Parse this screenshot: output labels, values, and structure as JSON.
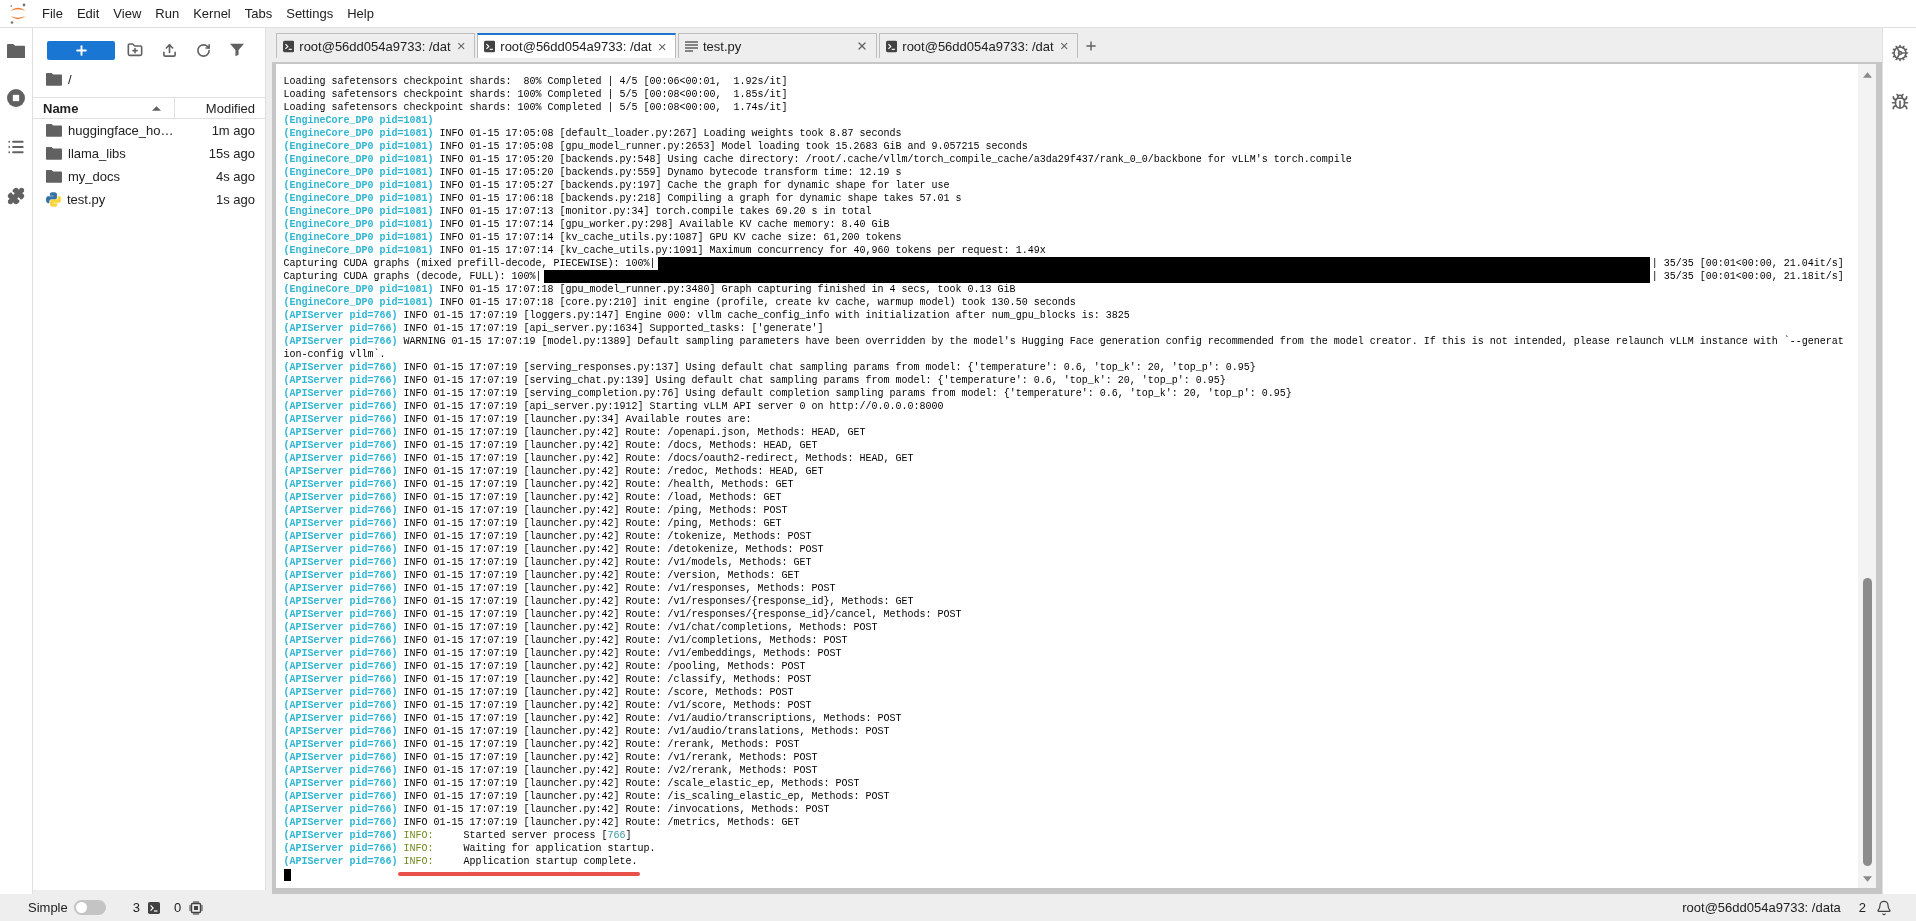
{
  "menu_bar": {
    "items": [
      "File",
      "Edit",
      "View",
      "Run",
      "Kernel",
      "Tabs",
      "Settings",
      "Help"
    ]
  },
  "file_browser": {
    "path": "/",
    "columns": [
      {
        "label": "Name",
        "sorted": true
      },
      {
        "label": "Modified",
        "sorted": false
      }
    ],
    "items": [
      {
        "kind": "folder",
        "name": "huggingface_ho…",
        "modified": "1m ago"
      },
      {
        "kind": "folder",
        "name": "llama_libs",
        "modified": "15s ago"
      },
      {
        "kind": "folder",
        "name": "my_docs",
        "modified": "4s ago"
      },
      {
        "kind": "python",
        "name": "test.py",
        "modified": "1s ago"
      }
    ]
  },
  "tabs": [
    {
      "kind": "terminal",
      "label": "root@56dd054a9733: /dat",
      "selected": false
    },
    {
      "kind": "terminal",
      "label": "root@56dd054a9733: /dat",
      "selected": true
    },
    {
      "kind": "editor",
      "label": "test.py",
      "selected": false
    },
    {
      "kind": "terminal",
      "label": "root@56dd054a9733: /dat",
      "selected": false
    }
  ],
  "terminal": {
    "lines": [
      {
        "kind": "log",
        "underlined": false,
        "segments": [
          {
            "kind": "message",
            "text": "Loading safetensors checkpoint shards:  80% Completed | 4/5 [00:06<00:01,  1.92s/it]"
          }
        ]
      },
      {
        "kind": "log",
        "underlined": false,
        "segments": [
          {
            "kind": "message",
            "text": "Loading safetensors checkpoint shards: 100% Completed | 5/5 [00:08<00:00,  1.85s/it]"
          }
        ]
      },
      {
        "kind": "log",
        "underlined": false,
        "segments": [
          {
            "kind": "message",
            "text": "Loading safetensors checkpoint shards: 100% Completed | 5/5 [00:08<00:00,  1.74s/it]"
          }
        ]
      },
      {
        "kind": "log",
        "underlined": false,
        "segments": [
          {
            "kind": "source",
            "text": "(EngineCore_DP0 pid=1081)"
          }
        ]
      },
      {
        "kind": "log",
        "underlined": false,
        "segments": [
          {
            "kind": "source",
            "text": "(EngineCore_DP0 pid=1081)"
          },
          {
            "kind": "message",
            "text": "INFO 01-15 17:05:08 [default_loader.py:267] Loading weights took 8.87 seconds"
          }
        ]
      },
      {
        "kind": "log",
        "underlined": false,
        "segments": [
          {
            "kind": "source",
            "text": "(EngineCore_DP0 pid=1081)"
          },
          {
            "kind": "message",
            "text": "INFO 01-15 17:05:08 [gpu_model_runner.py:2653] Model loading took 15.2683 GiB and 9.057215 seconds"
          }
        ]
      },
      {
        "kind": "log",
        "underlined": false,
        "segments": [
          {
            "kind": "source",
            "text": "(EngineCore_DP0 pid=1081)"
          },
          {
            "kind": "message",
            "text": "INFO 01-15 17:05:20 [backends.py:548] Using cache directory: /root/.cache/vllm/torch_compile_cache/a3da29f437/rank_0_0/backbone for vLLM's torch.compile"
          }
        ]
      },
      {
        "kind": "log",
        "underlined": false,
        "segments": [
          {
            "kind": "source",
            "text": "(EngineCore_DP0 pid=1081)"
          },
          {
            "kind": "message",
            "text": "INFO 01-15 17:05:20 [backends.py:559] Dynamo bytecode transform time: 12.19 s"
          }
        ]
      },
      {
        "kind": "log",
        "underlined": false,
        "segments": [
          {
            "kind": "source",
            "text": "(EngineCore_DP0 pid=1081)"
          },
          {
            "kind": "message",
            "text": "INFO 01-15 17:05:27 [backends.py:197] Cache the graph for dynamic shape for later use"
          }
        ]
      },
      {
        "kind": "log",
        "underlined": false,
        "segments": [
          {
            "kind": "source",
            "text": "(EngineCore_DP0 pid=1081)"
          },
          {
            "kind": "message",
            "text": "INFO 01-15 17:06:18 [backends.py:218] Compiling a graph for dynamic shape takes 57.01 s"
          }
        ]
      },
      {
        "kind": "log",
        "underlined": false,
        "segments": [
          {
            "kind": "source",
            "text": "(EngineCore_DP0 pid=1081)"
          },
          {
            "kind": "message",
            "text": "INFO 01-15 17:07:13 [monitor.py:34] torch.compile takes 69.20 s in total"
          }
        ]
      },
      {
        "kind": "log",
        "underlined": false,
        "segments": [
          {
            "kind": "source",
            "text": "(EngineCore_DP0 pid=1081)"
          },
          {
            "kind": "message",
            "text": "INFO 01-15 17:07:14 [gpu_worker.py:298] Available KV cache memory: 8.40 GiB"
          }
        ]
      },
      {
        "kind": "log",
        "underlined": false,
        "segments": [
          {
            "kind": "source",
            "text": "(EngineCore_DP0 pid=1081)"
          },
          {
            "kind": "message",
            "text": "INFO 01-15 17:07:14 [kv_cache_utils.py:1087] GPU KV cache size: 61,200 tokens"
          }
        ]
      },
      {
        "kind": "log",
        "underlined": false,
        "segments": [
          {
            "kind": "source",
            "text": "(EngineCore_DP0 pid=1081)"
          },
          {
            "kind": "message",
            "text": "INFO 01-15 17:07:14 [kv_cache_utils.py:1091] Maximum concurrency for 40,960 tokens per request: 1.49x"
          }
        ]
      },
      {
        "kind": "progress",
        "underlined": false,
        "label": "Capturing CUDA graphs (mixed prefill-decode, PIECEWISE): 100%|",
        "level": 1,
        "stats": "| 35/35 [00:01<00:00, 21.04it/s]"
      },
      {
        "kind": "progress",
        "underlined": false,
        "label": "Capturing CUDA graphs (decode, FULL): 100%|",
        "level": 1,
        "stats": "| 35/35 [00:01<00:00, 21.18it/s]"
      },
      {
        "kind": "log",
        "underlined": false,
        "segments": [
          {
            "kind": "source",
            "text": "(EngineCore_DP0 pid=1081)"
          },
          {
            "kind": "message",
            "text": "INFO 01-15 17:07:18 [gpu_model_runner.py:3480] Graph capturing finished in 4 secs, took 0.13 GiB"
          }
        ]
      },
      {
        "kind": "log",
        "underlined": false,
        "segments": [
          {
            "kind": "source",
            "text": "(EngineCore_DP0 pid=1081)"
          },
          {
            "kind": "message",
            "text": "INFO 01-15 17:07:18 [core.py:210] init engine (profile, create kv cache, warmup model) took 130.50 seconds"
          }
        ]
      },
      {
        "kind": "log",
        "underlined": false,
        "segments": [
          {
            "kind": "source",
            "text": "(APIServer pid=766)"
          },
          {
            "kind": "message",
            "text": "INFO 01-15 17:07:19 [loggers.py:147] Engine 000: vllm cache_config_info with initialization after num_gpu_blocks is: 3825"
          }
        ]
      },
      {
        "kind": "log",
        "underlined": false,
        "segments": [
          {
            "kind": "source",
            "text": "(APIServer pid=766)"
          },
          {
            "kind": "message",
            "text": "INFO 01-15 17:07:19 [api_server.py:1634] Supported_tasks: ['generate']"
          }
        ]
      },
      {
        "kind": "log",
        "underlined": false,
        "segments": [
          {
            "kind": "source",
            "text": "(APIServer pid=766)"
          },
          {
            "kind": "message",
            "text": "WARNING 01-15 17:07:19 [model.py:1389] Default sampling parameters have been overridden by the model's Hugging Face generation config recommended from the model creator. If this is not intended, please relaunch vLLM instance with `--generat"
          }
        ]
      },
      {
        "kind": "log",
        "underlined": false,
        "segments": [
          {
            "kind": "message",
            "text": "ion-config vllm`."
          }
        ]
      },
      {
        "kind": "log",
        "underlined": false,
        "segments": [
          {
            "kind": "source",
            "text": "(APIServer pid=766)"
          },
          {
            "kind": "message",
            "text": "INFO 01-15 17:07:19 [serving_responses.py:137] Using default chat sampling params from model: {'temperature': 0.6, 'top_k': 20, 'top_p': 0.95}"
          }
        ]
      },
      {
        "kind": "log",
        "underlined": false,
        "segments": [
          {
            "kind": "source",
            "text": "(APIServer pid=766)"
          },
          {
            "kind": "message",
            "text": "INFO 01-15 17:07:19 [serving_chat.py:139] Using default chat sampling params from model: {'temperature': 0.6, 'top_k': 20, 'top_p': 0.95}"
          }
        ]
      },
      {
        "kind": "log",
        "underlined": false,
        "segments": [
          {
            "kind": "source",
            "text": "(APIServer pid=766)"
          },
          {
            "kind": "message",
            "text": "INFO 01-15 17:07:19 [serving_completion.py:76] Using default completion sampling params from model: {'temperature': 0.6, 'top_k': 20, 'top_p': 0.95}"
          }
        ]
      },
      {
        "kind": "log",
        "underlined": false,
        "segments": [
          {
            "kind": "source",
            "text": "(APIServer pid=766)"
          },
          {
            "kind": "message",
            "text": "INFO 01-15 17:07:19 [api_server.py:1912] Starting vLLM API server 0 on http://0.0.0.0:8000"
          }
        ]
      },
      {
        "kind": "log",
        "underlined": false,
        "segments": [
          {
            "kind": "source",
            "text": "(APIServer pid=766)"
          },
          {
            "kind": "message",
            "text": "INFO 01-15 17:07:19 [launcher.py:34] Available routes are:"
          }
        ]
      },
      {
        "kind": "log",
        "underlined": false,
        "segments": [
          {
            "kind": "source",
            "text": "(APIServer pid=766)"
          },
          {
            "kind": "message",
            "text": "INFO 01-15 17:07:19 [launcher.py:42] Route: /openapi.json, Methods: HEAD, GET"
          }
        ]
      },
      {
        "kind": "log",
        "underlined": false,
        "segments": [
          {
            "kind": "source",
            "text": "(APIServer pid=766)"
          },
          {
            "kind": "message",
            "text": "INFO 01-15 17:07:19 [launcher.py:42] Route: /docs, Methods: HEAD, GET"
          }
        ]
      },
      {
        "kind": "log",
        "underlined": false,
        "segments": [
          {
            "kind": "source",
            "text": "(APIServer pid=766)"
          },
          {
            "kind": "message",
            "text": "INFO 01-15 17:07:19 [launcher.py:42] Route: /docs/oauth2-redirect, Methods: HEAD, GET"
          }
        ]
      },
      {
        "kind": "log",
        "underlined": false,
        "segments": [
          {
            "kind": "source",
            "text": "(APIServer pid=766)"
          },
          {
            "kind": "message",
            "text": "INFO 01-15 17:07:19 [launcher.py:42] Route: /redoc, Methods: HEAD, GET"
          }
        ]
      },
      {
        "kind": "log",
        "underlined": false,
        "segments": [
          {
            "kind": "source",
            "text": "(APIServer pid=766)"
          },
          {
            "kind": "message",
            "text": "INFO 01-15 17:07:19 [launcher.py:42] Route: /health, Methods: GET"
          }
        ]
      },
      {
        "kind": "log",
        "underlined": false,
        "segments": [
          {
            "kind": "source",
            "text": "(APIServer pid=766)"
          },
          {
            "kind": "message",
            "text": "INFO 01-15 17:07:19 [launcher.py:42] Route: /load, Methods: GET"
          }
        ]
      },
      {
        "kind": "log",
        "underlined": false,
        "segments": [
          {
            "kind": "source",
            "text": "(APIServer pid=766)"
          },
          {
            "kind": "message",
            "text": "INFO 01-15 17:07:19 [launcher.py:42] Route: /ping, Methods: POST"
          }
        ]
      },
      {
        "kind": "log",
        "underlined": false,
        "segments": [
          {
            "kind": "source",
            "text": "(APIServer pid=766)"
          },
          {
            "kind": "message",
            "text": "INFO 01-15 17:07:19 [launcher.py:42] Route: /ping, Methods: GET"
          }
        ]
      },
      {
        "kind": "log",
        "underlined": false,
        "segments": [
          {
            "kind": "source",
            "text": "(APIServer pid=766)"
          },
          {
            "kind": "message",
            "text": "INFO 01-15 17:07:19 [launcher.py:42] Route: /tokenize, Methods: POST"
          }
        ]
      },
      {
        "kind": "log",
        "underlined": false,
        "segments": [
          {
            "kind": "source",
            "text": "(APIServer pid=766)"
          },
          {
            "kind": "message",
            "text": "INFO 01-15 17:07:19 [launcher.py:42] Route: /detokenize, Methods: POST"
          }
        ]
      },
      {
        "kind": "log",
        "underlined": false,
        "segments": [
          {
            "kind": "source",
            "text": "(APIServer pid=766)"
          },
          {
            "kind": "message",
            "text": "INFO 01-15 17:07:19 [launcher.py:42] Route: /v1/models, Methods: GET"
          }
        ]
      },
      {
        "kind": "log",
        "underlined": false,
        "segments": [
          {
            "kind": "source",
            "text": "(APIServer pid=766)"
          },
          {
            "kind": "message",
            "text": "INFO 01-15 17:07:19 [launcher.py:42] Route: /version, Methods: GET"
          }
        ]
      },
      {
        "kind": "log",
        "underlined": false,
        "segments": [
          {
            "kind": "source",
            "text": "(APIServer pid=766)"
          },
          {
            "kind": "message",
            "text": "INFO 01-15 17:07:19 [launcher.py:42] Route: /v1/responses, Methods: POST"
          }
        ]
      },
      {
        "kind": "log",
        "underlined": false,
        "segments": [
          {
            "kind": "source",
            "text": "(APIServer pid=766)"
          },
          {
            "kind": "message",
            "text": "INFO 01-15 17:07:19 [launcher.py:42] Route: /v1/responses/{response_id}, Methods: GET"
          }
        ]
      },
      {
        "kind": "log",
        "underlined": false,
        "segments": [
          {
            "kind": "source",
            "text": "(APIServer pid=766)"
          },
          {
            "kind": "message",
            "text": "INFO 01-15 17:07:19 [launcher.py:42] Route: /v1/responses/{response_id}/cancel, Methods: POST"
          }
        ]
      },
      {
        "kind": "log",
        "underlined": false,
        "segments": [
          {
            "kind": "source",
            "text": "(APIServer pid=766)"
          },
          {
            "kind": "message",
            "text": "INFO 01-15 17:07:19 [launcher.py:42] Route: /v1/chat/completions, Methods: POST"
          }
        ]
      },
      {
        "kind": "log",
        "underlined": false,
        "segments": [
          {
            "kind": "source",
            "text": "(APIServer pid=766)"
          },
          {
            "kind": "message",
            "text": "INFO 01-15 17:07:19 [launcher.py:42] Route: /v1/completions, Methods: POST"
          }
        ]
      },
      {
        "kind": "log",
        "underlined": false,
        "segments": [
          {
            "kind": "source",
            "text": "(APIServer pid=766)"
          },
          {
            "kind": "message",
            "text": "INFO 01-15 17:07:19 [launcher.py:42] Route: /v1/embeddings, Methods: POST"
          }
        ]
      },
      {
        "kind": "log",
        "underlined": false,
        "segments": [
          {
            "kind": "source",
            "text": "(APIServer pid=766)"
          },
          {
            "kind": "message",
            "text": "INFO 01-15 17:07:19 [launcher.py:42] Route: /pooling, Methods: POST"
          }
        ]
      },
      {
        "kind": "log",
        "underlined": false,
        "segments": [
          {
            "kind": "source",
            "text": "(APIServer pid=766)"
          },
          {
            "kind": "message",
            "text": "INFO 01-15 17:07:19 [launcher.py:42] Route: /classify, Methods: POST"
          }
        ]
      },
      {
        "kind": "log",
        "underlined": false,
        "segments": [
          {
            "kind": "source",
            "text": "(APIServer pid=766)"
          },
          {
            "kind": "message",
            "text": "INFO 01-15 17:07:19 [launcher.py:42] Route: /score, Methods: POST"
          }
        ]
      },
      {
        "kind": "log",
        "underlined": false,
        "segments": [
          {
            "kind": "source",
            "text": "(APIServer pid=766)"
          },
          {
            "kind": "message",
            "text": "INFO 01-15 17:07:19 [launcher.py:42] Route: /v1/score, Methods: POST"
          }
        ]
      },
      {
        "kind": "log",
        "underlined": false,
        "segments": [
          {
            "kind": "source",
            "text": "(APIServer pid=766)"
          },
          {
            "kind": "message",
            "text": "INFO 01-15 17:07:19 [launcher.py:42] Route: /v1/audio/transcriptions, Methods: POST"
          }
        ]
      },
      {
        "kind": "log",
        "underlined": false,
        "segments": [
          {
            "kind": "source",
            "text": "(APIServer pid=766)"
          },
          {
            "kind": "message",
            "text": "INFO 01-15 17:07:19 [launcher.py:42] Route: /v1/audio/translations, Methods: POST"
          }
        ]
      },
      {
        "kind": "log",
        "underlined": false,
        "segments": [
          {
            "kind": "source",
            "text": "(APIServer pid=766)"
          },
          {
            "kind": "message",
            "text": "INFO 01-15 17:07:19 [launcher.py:42] Route: /rerank, Methods: POST"
          }
        ]
      },
      {
        "kind": "log",
        "underlined": false,
        "segments": [
          {
            "kind": "source",
            "text": "(APIServer pid=766)"
          },
          {
            "kind": "message",
            "text": "INFO 01-15 17:07:19 [launcher.py:42] Route: /v1/rerank, Methods: POST"
          }
        ]
      },
      {
        "kind": "log",
        "underlined": false,
        "segments": [
          {
            "kind": "source",
            "text": "(APIServer pid=766)"
          },
          {
            "kind": "message",
            "text": "INFO 01-15 17:07:19 [launcher.py:42] Route: /v2/rerank, Methods: POST"
          }
        ]
      },
      {
        "kind": "log",
        "underlined": false,
        "segments": [
          {
            "kind": "source",
            "text": "(APIServer pid=766)"
          },
          {
            "kind": "message",
            "text": "INFO 01-15 17:07:19 [launcher.py:42] Route: /scale_elastic_ep, Methods: POST"
          }
        ]
      },
      {
        "kind": "log",
        "underlined": false,
        "segments": [
          {
            "kind": "source",
            "text": "(APIServer pid=766)"
          },
          {
            "kind": "message",
            "text": "INFO 01-15 17:07:19 [launcher.py:42] Route: /is_scaling_elastic_ep, Methods: POST"
          }
        ]
      },
      {
        "kind": "log",
        "underlined": false,
        "segments": [
          {
            "kind": "source",
            "text": "(APIServer pid=766)"
          },
          {
            "kind": "message",
            "text": "INFO 01-15 17:07:19 [launcher.py:42] Route: /invocations, Methods: POST"
          }
        ]
      },
      {
        "kind": "log",
        "underlined": false,
        "segments": [
          {
            "kind": "source",
            "text": "(APIServer pid=766)"
          },
          {
            "kind": "message",
            "text": "INFO 01-15 17:07:19 [launcher.py:42] Route: /metrics, Methods: GET"
          }
        ]
      },
      {
        "kind": "log",
        "underlined": false,
        "segments": [
          {
            "kind": "source",
            "text": "(APIServer pid=766)"
          },
          {
            "kind": "tag",
            "text": "INFO:"
          },
          {
            "kind": "message",
            "text": "Started server process ["
          },
          {
            "kind": "number",
            "text": "766"
          },
          {
            "kind": "message",
            "text": "]"
          }
        ]
      },
      {
        "kind": "log",
        "underlined": false,
        "segments": [
          {
            "kind": "source",
            "text": "(APIServer pid=766)"
          },
          {
            "kind": "tag",
            "text": "INFO:"
          },
          {
            "kind": "message",
            "text": "Waiting for application startup."
          }
        ]
      },
      {
        "kind": "log",
        "underlined": true,
        "segments": [
          {
            "kind": "source",
            "text": "(APIServer pid=766)"
          },
          {
            "kind": "tag",
            "text": "INFO:"
          },
          {
            "kind": "message",
            "text": "Application startup complete."
          }
        ]
      },
      {
        "kind": "cursor",
        "underlined": false
      }
    ]
  },
  "status_bar": {
    "mode_label": "Simple",
    "mode_on": false,
    "terminals": "3",
    "kernels": "0",
    "title": "root@56dd054a9733: /data",
    "notifications": "2"
  }
}
